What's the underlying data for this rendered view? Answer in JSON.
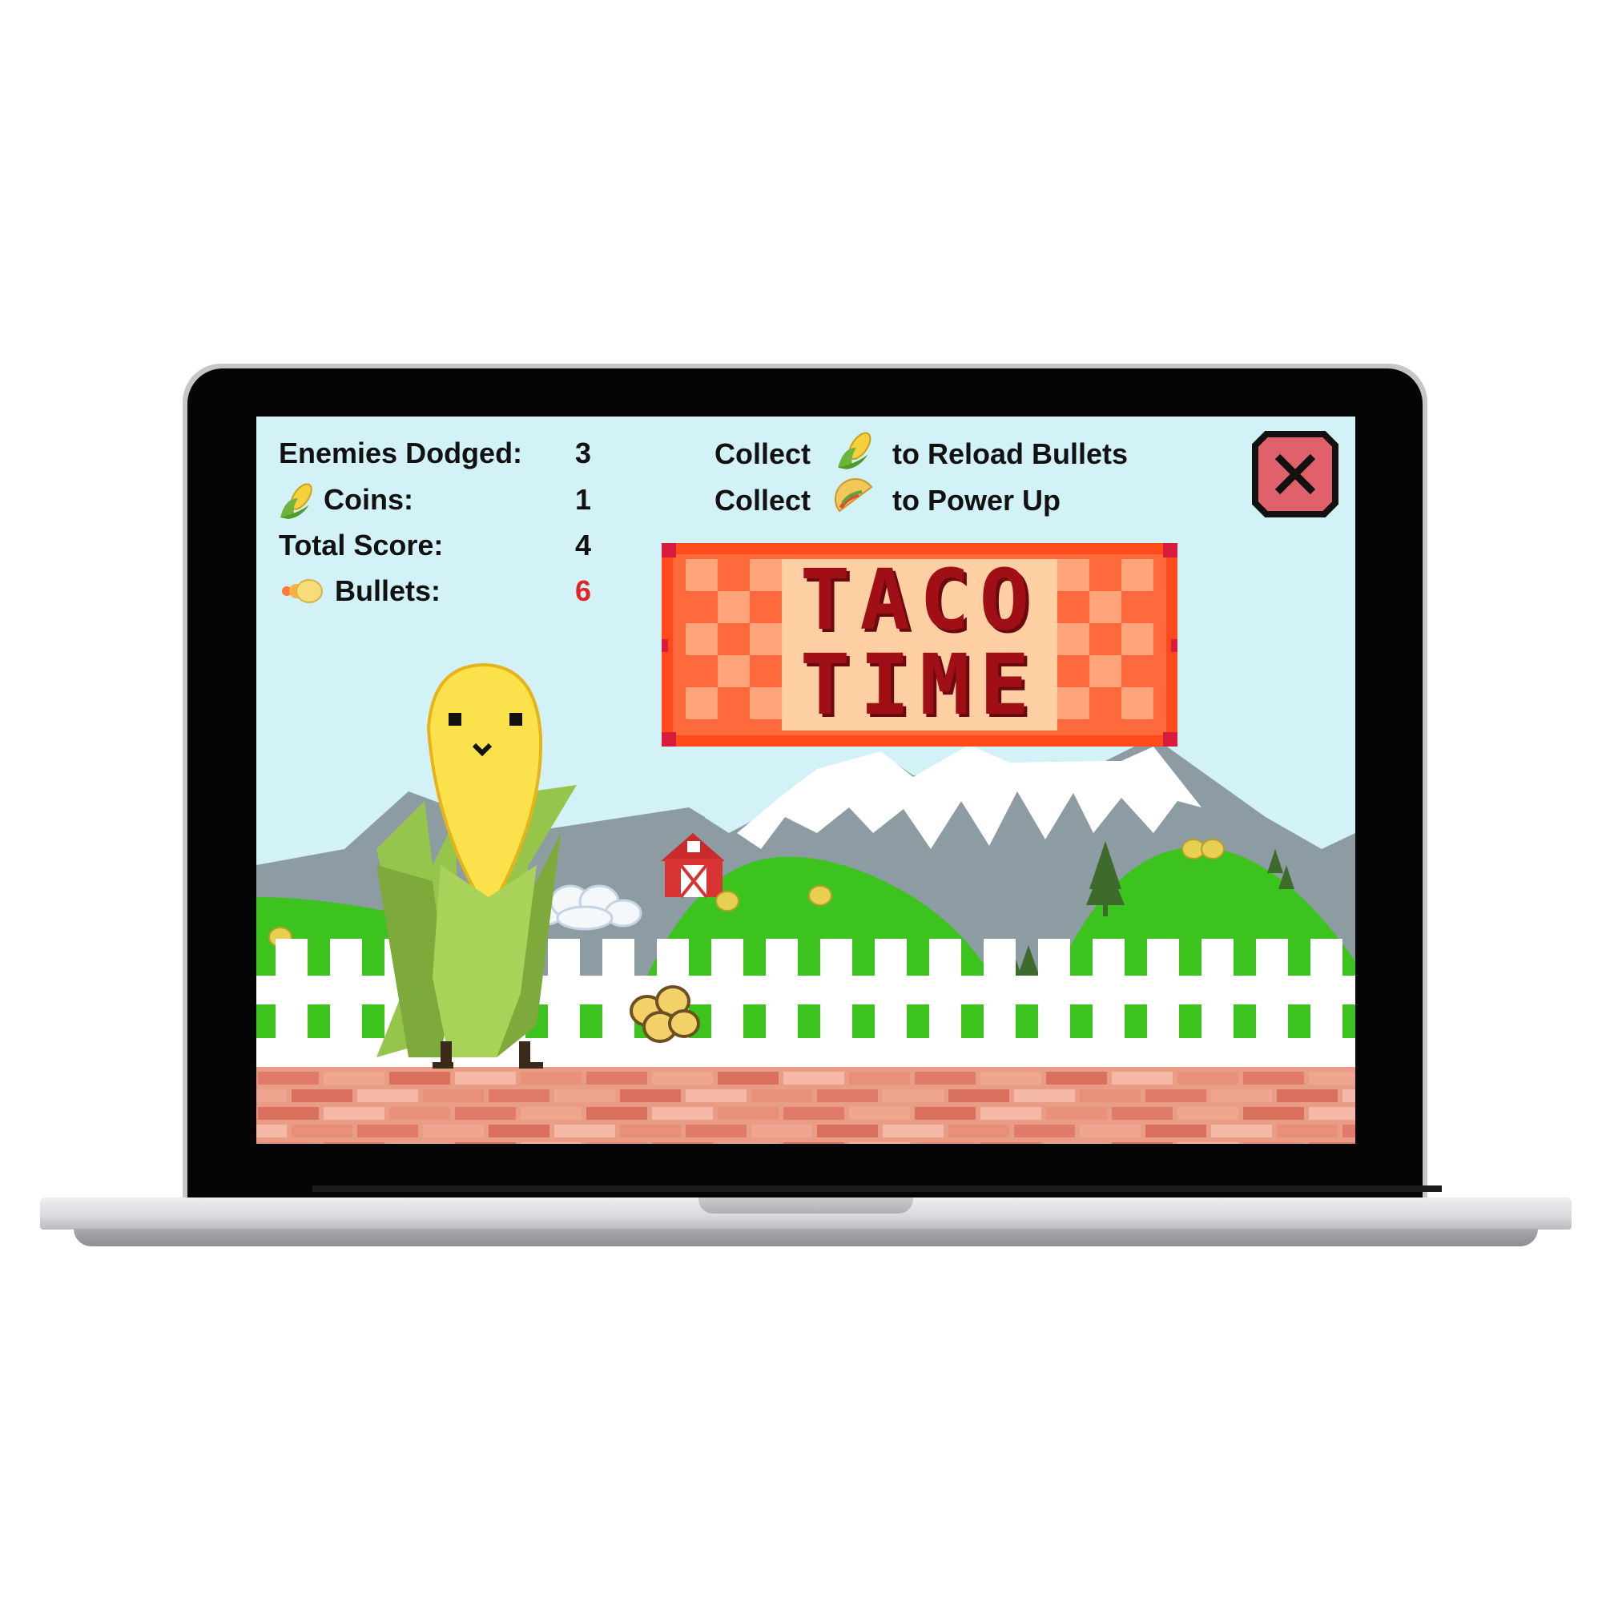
{
  "hud": {
    "enemies_dodged_label": "Enemies Dodged:",
    "enemies_dodged_value": "3",
    "coins_label": "Coins:",
    "coins_value": "1",
    "total_score_label": "Total Score:",
    "total_score_value": "4",
    "bullets_label": "Bullets:",
    "bullets_value": "6"
  },
  "hints": {
    "collect_word_1": "Collect",
    "reload_text": "to Reload Bullets",
    "collect_word_2": "Collect",
    "powerup_text": "to Power Up"
  },
  "banner": {
    "line1": "TACO",
    "line2": "TIME"
  },
  "colors": {
    "sky": "#d2f2f8",
    "hill_green": "#3cc31d",
    "mountain_gray": "#8d9ca3",
    "banner_orange": "#ff6a3c",
    "close_red": "#e0606b",
    "bullets_red": "#e32222"
  },
  "icons": [
    "corn-icon",
    "taco-icon",
    "bullet-icon",
    "close-icon"
  ]
}
